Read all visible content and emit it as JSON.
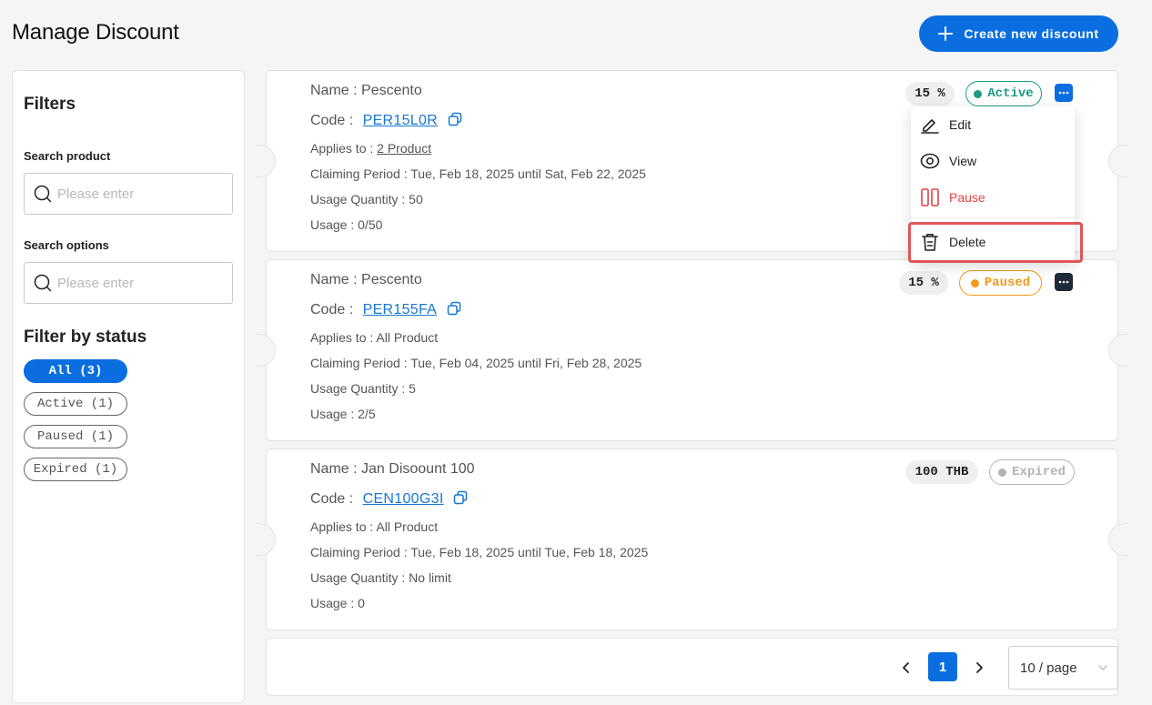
{
  "page": {
    "title": "Manage Discount"
  },
  "header": {
    "create_label": "Create new discount"
  },
  "filters": {
    "title": "Filters",
    "search_product": {
      "label": "Search product",
      "placeholder": "Please enter",
      "value": ""
    },
    "search_options": {
      "label": "Search options",
      "placeholder": "Please enter",
      "value": ""
    },
    "status_title": "Filter by status",
    "statuses": [
      {
        "label": "All (3)",
        "selected": true
      },
      {
        "label": "Active (1)",
        "selected": false
      },
      {
        "label": "Paused (1)",
        "selected": false
      },
      {
        "label": "Expired (1)",
        "selected": false
      }
    ]
  },
  "discounts": [
    {
      "name_label": "Name : Pescento",
      "code_prefix": "Code :",
      "code": "PER15L0R",
      "applies_prefix": "Applies to :",
      "applies": "2 Product",
      "period": "Claiming Period : Tue, Feb 18, 2025 until Sat, Feb 22, 2025",
      "usage_qty": "Usage Quantity : 50",
      "usage": "Usage : 0/50",
      "amount": "15 %",
      "status": "Active",
      "status_color": "#1a9b82"
    },
    {
      "name_label": "Name : Pescento",
      "code_prefix": "Code :",
      "code": "PER155FA",
      "applies_prefix": "Applies to :",
      "applies": "All Product",
      "period": "Claiming Period : Tue, Feb 04, 2025 until Fri, Feb 28, 2025",
      "usage_qty": "Usage Quantity : 5",
      "usage": "Usage : 2/5",
      "amount": "15 %",
      "status": "Paused",
      "status_color": "#f29a1c"
    },
    {
      "name_label": "Name : Jan Disoount 100",
      "code_prefix": "Code :",
      "code": "CEN100G3I",
      "applies_prefix": "Applies to :",
      "applies": "All Product",
      "period": "Claiming Period : Tue, Feb 18, 2025 until Tue, Feb 18, 2025",
      "usage_qty": "Usage Quantity : No limit",
      "usage": "Usage : 0",
      "amount": "100 THB",
      "status": "Expired",
      "status_color": "#b3b3b3"
    }
  ],
  "menu": {
    "edit": "Edit",
    "view": "View",
    "pause": "Pause",
    "delete": "Delete"
  },
  "pagination": {
    "current": "1",
    "page_size": "10 / page"
  },
  "colors": {
    "accent": "#0a6ee0",
    "danger": "#e04343",
    "highlight": "#e05555"
  }
}
